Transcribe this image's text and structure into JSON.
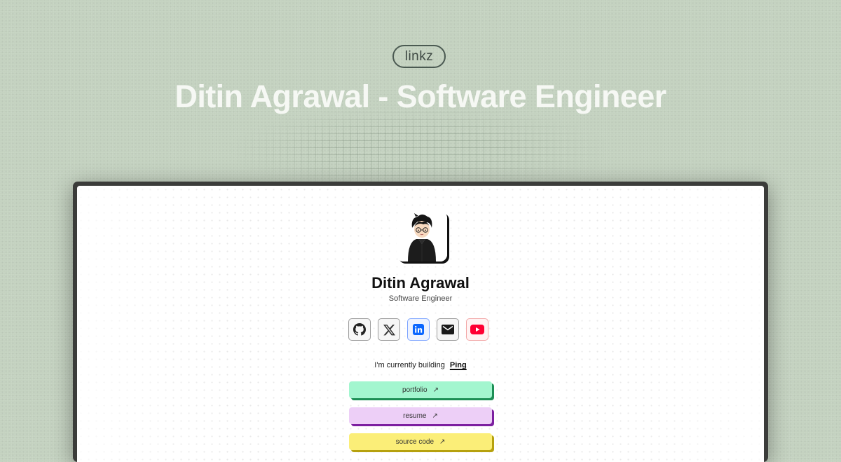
{
  "badge": {
    "label": "linkz"
  },
  "page": {
    "title": "Ditin Agrawal - Software Engineer"
  },
  "profile": {
    "name": "Ditin Agrawal",
    "role": "Software Engineer"
  },
  "socials": [
    {
      "name": "github",
      "icon": "github-icon"
    },
    {
      "name": "x",
      "icon": "x-icon"
    },
    {
      "name": "linkedin",
      "icon": "linkedin-icon",
      "color": "#0a66ff"
    },
    {
      "name": "email",
      "icon": "mail-icon"
    },
    {
      "name": "youtube",
      "icon": "youtube-icon",
      "color": "#ff0033"
    }
  ],
  "building": {
    "prefix": "I'm currently building",
    "project": "Ping"
  },
  "links": [
    {
      "label": "portfolio",
      "arrow": "↗",
      "color": "#a3f6cf"
    },
    {
      "label": "resume",
      "arrow": "↗",
      "color": "#edcff7"
    },
    {
      "label": "source code",
      "arrow": "↗",
      "color": "#fbee78"
    }
  ],
  "colors": {
    "background": "#c3d1bf",
    "title": "#f6f8f4",
    "frame": "#3b3c3a"
  }
}
